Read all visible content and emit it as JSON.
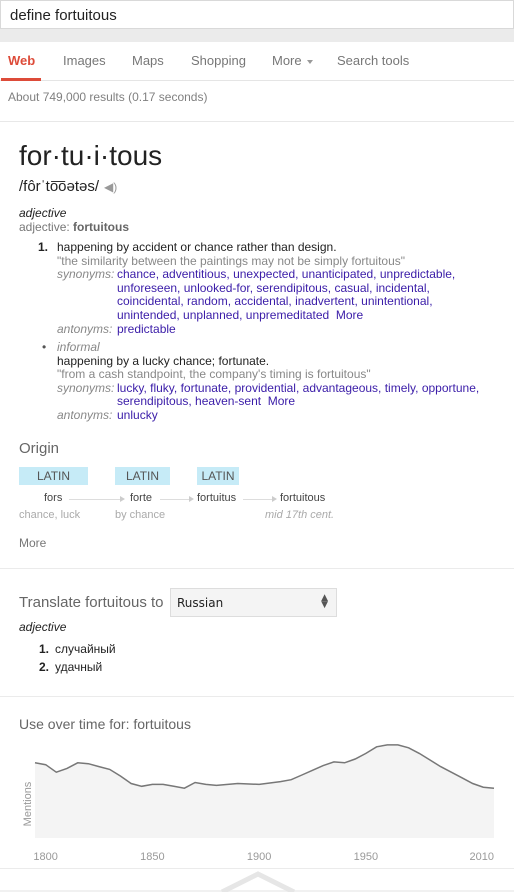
{
  "search": {
    "query": "define fortuitous"
  },
  "tabs": [
    {
      "label": "Web",
      "active": true
    },
    {
      "label": "Images"
    },
    {
      "label": "Maps"
    },
    {
      "label": "Shopping"
    },
    {
      "label": "More"
    },
    {
      "label": "Search tools"
    }
  ],
  "results_count": "About 749,000 results (0.17 seconds)",
  "entry": {
    "word": "for·tu·i·tous",
    "phonetic": "/fôrˈto͞oətəs/",
    "speaker_icon": "speaker-icon",
    "pos": "adjective",
    "pos_label": "adjective: ",
    "pos_word": "fortuitous",
    "senses": [
      {
        "number": "1.",
        "definition": "happening by accident or chance rather than design.",
        "example": "\"the similarity between the paintings may not be simply fortuitous\"",
        "synonyms_label": "synonyms:",
        "synonyms": "chance, adventitious, unexpected, unanticipated, unpredictable, unforeseen, unlooked-for, serendipitous, casual, incidental, coincidental, random, accidental, inadvertent, unintentional, unintended, unplanned, unpremeditated",
        "more": "More",
        "antonyms_label": "antonyms:",
        "antonyms": "predictable"
      },
      {
        "number": "•",
        "register": "informal",
        "definition": "happening by a lucky chance; fortunate.",
        "example": "\"from a cash standpoint, the company's timing is fortuitous\"",
        "synonyms_label": "synonyms:",
        "synonyms": "lucky, fluky, fortunate, providential, advantageous, timely, opportune, serendipitous, heaven-sent",
        "more": "More",
        "antonyms_label": "antonyms:",
        "antonyms": "unlucky"
      }
    ]
  },
  "origin": {
    "title": "Origin",
    "steps": [
      {
        "lang": "LATIN",
        "word": "fors",
        "gloss": "chance, luck"
      },
      {
        "lang": "LATIN",
        "word": "forte",
        "gloss": "by chance"
      },
      {
        "lang": "LATIN",
        "word": "fortuitus",
        "gloss": ""
      },
      {
        "lang": "",
        "word": "fortuitous",
        "gloss": "mid 17th cent."
      }
    ],
    "more": "More"
  },
  "translate": {
    "label": "Translate fortuitous to",
    "language": "Russian",
    "pos": "adjective",
    "items": [
      {
        "n": "1.",
        "text": "случайный"
      },
      {
        "n": "2.",
        "text": "удачный"
      }
    ]
  },
  "chart_data": {
    "type": "area",
    "title": "Use over time for: fortuitous",
    "ylabel": "Mentions",
    "xlabel": "",
    "x_ticks": [
      "1800",
      "1850",
      "1900",
      "1950",
      "2010"
    ],
    "xlim": [
      1795,
      2010
    ],
    "ylim": [
      0,
      100
    ],
    "grid": false,
    "colors": {
      "line": "#777777",
      "fill": "#f4f4f4"
    },
    "x": [
      1795,
      1800,
      1805,
      1810,
      1815,
      1820,
      1825,
      1830,
      1835,
      1840,
      1845,
      1850,
      1855,
      1860,
      1865,
      1870,
      1875,
      1880,
      1890,
      1900,
      1910,
      1915,
      1920,
      1925,
      1930,
      1935,
      1940,
      1945,
      1950,
      1955,
      1960,
      1965,
      1970,
      1975,
      1980,
      1985,
      1990,
      1995,
      2000,
      2005,
      2010
    ],
    "y": [
      80,
      78,
      70,
      74,
      80,
      79,
      76,
      73,
      66,
      58,
      55,
      57,
      57,
      55,
      53,
      59,
      57,
      56,
      58,
      57,
      60,
      62,
      67,
      72,
      77,
      81,
      80,
      84,
      90,
      97,
      99,
      99,
      96,
      90,
      83,
      76,
      70,
      64,
      58,
      54,
      53
    ]
  }
}
